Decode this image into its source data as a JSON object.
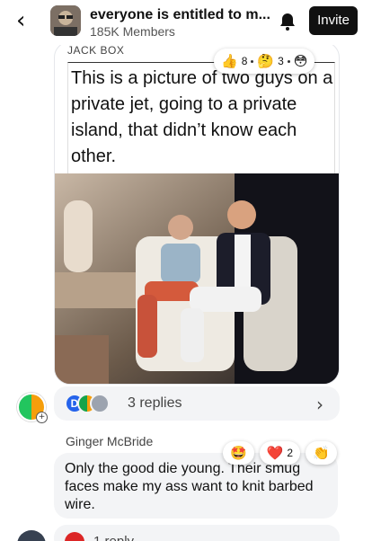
{
  "header": {
    "back_icon": "back-chevron-icon",
    "group_name": "everyone is entitled to m...",
    "members": "185K Members",
    "bell_icon": "bell-icon",
    "invite_label": "Invite"
  },
  "post": {
    "author": "Jack Box",
    "meme_text": "This is a picture of two guys on a private jet, going to a private island, that didn’t know each other.",
    "reactions": [
      {
        "emoji": "👍",
        "count": "8"
      },
      {
        "emoji": "🤔",
        "count": "3"
      },
      {
        "emoji": "😳",
        "count": ""
      }
    ]
  },
  "replies": {
    "label": "3 replies",
    "first_initial": "D"
  },
  "comment": {
    "author": "Ginger McBride",
    "text": "Only the good die young. Their smug faces make my ass want to knit barbed wire.",
    "reactions": [
      {
        "emoji": "🤩",
        "count": ""
      },
      {
        "emoji": "❤️",
        "count": "2"
      },
      {
        "emoji": "👏",
        "count": ""
      }
    ]
  },
  "next": {
    "label": "1 reply"
  },
  "colors": {
    "invite_bg": "#111111",
    "bubble_bg": "#f3f4f6"
  }
}
